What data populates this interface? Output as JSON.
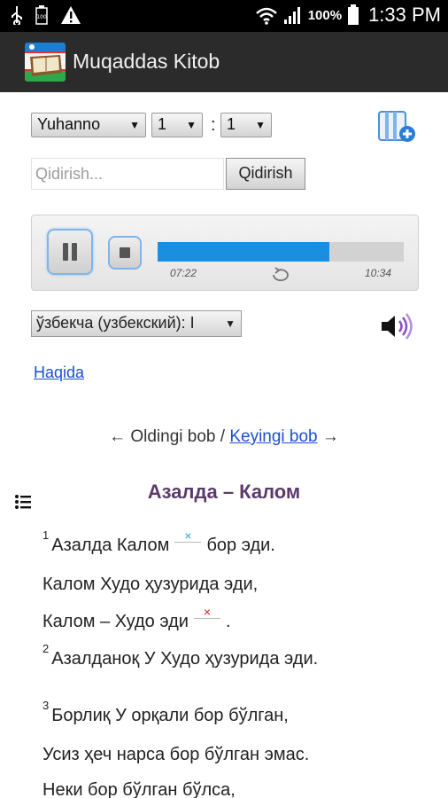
{
  "status_bar": {
    "battery_percent": "100%",
    "time": "1:33 PM",
    "icons": [
      "usb-icon",
      "battery-saver-icon",
      "warning-icon",
      "wifi-icon",
      "signal-icon",
      "battery-icon"
    ]
  },
  "action_bar": {
    "title": "Muqaddas Kitob",
    "icon": "bible-app-icon"
  },
  "selectors": {
    "book": "Yuhanno",
    "chapter": "1",
    "separator": ":",
    "verse": "1"
  },
  "search": {
    "placeholder": "Qidirish...",
    "button_label": "Qidirish"
  },
  "player": {
    "elapsed": "07:22",
    "total": "10:34",
    "progress": 0.697
  },
  "language": {
    "selected": "ўзбекча (узбекский): I"
  },
  "about_link": "Haqida",
  "navigation": {
    "prev": "← Oldingi bob",
    "separator": "/",
    "next": "Keyingi bob",
    "next_arrow": "→"
  },
  "content": {
    "heading": "Азалда – Калом",
    "lines": [
      {
        "num": "1",
        "text_a": "Азалда Калом",
        "fn": "×",
        "fn_color": "blue",
        "text_b": "бор эди."
      },
      {
        "num": "",
        "text_a": "Калом Худо ҳузурида эди,"
      },
      {
        "num": "",
        "text_a": "Калом – Худо эди",
        "fn": "×",
        "fn_color": "red",
        "text_b": "."
      },
      {
        "num": "2",
        "text_a": "Азалданоқ У Худо ҳузурида эди."
      },
      {
        "num": "3",
        "text_a": "Борлиқ У орқали бор бўлган,"
      },
      {
        "num": "",
        "text_a": "Усиз ҳеч нарса бор бўлган эмас."
      },
      {
        "num": "",
        "text_a": "Неки бор бўлган бўлса,"
      }
    ]
  },
  "colors": {
    "status_bar": "#000000",
    "action_bar": "#2b2b2b",
    "progress_fill": "#1a8fe0",
    "heading": "#5b3a6b",
    "link": "#1a4fd0"
  }
}
